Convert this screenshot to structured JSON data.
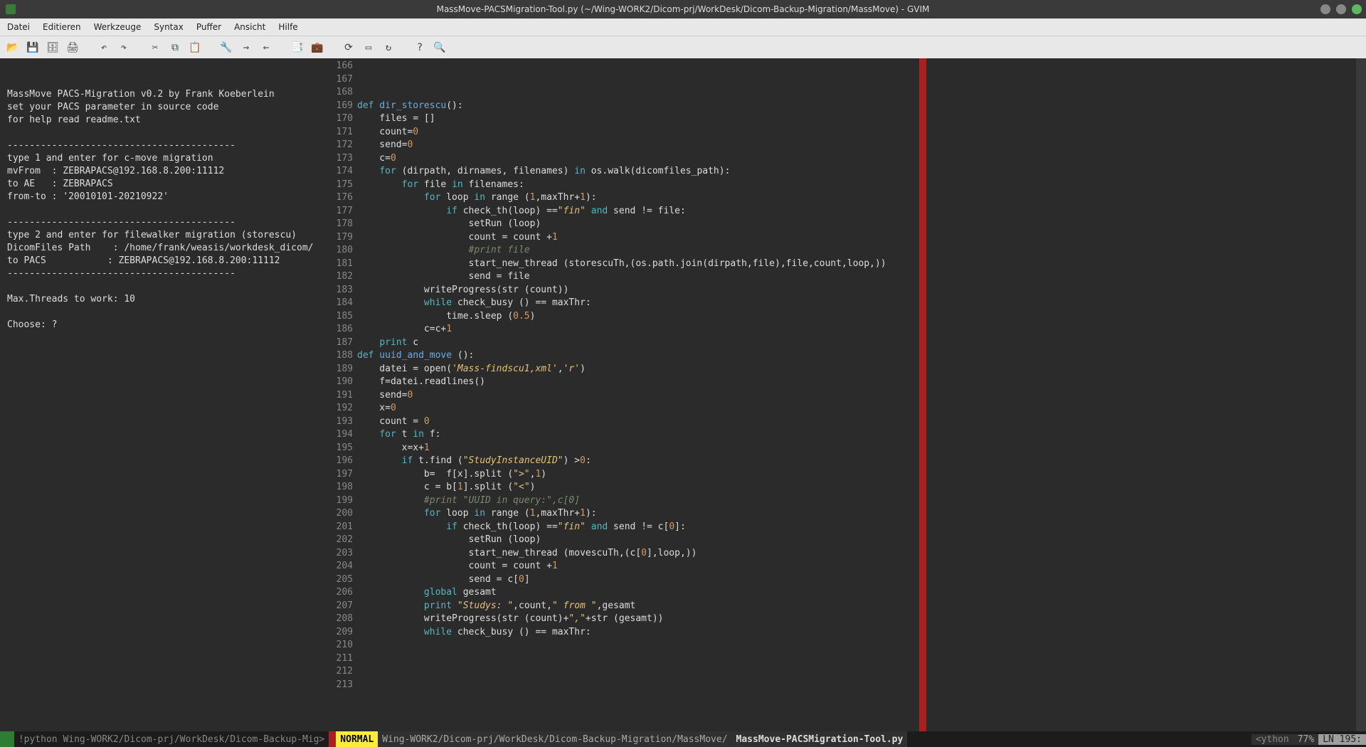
{
  "window": {
    "title": "MassMove-PACSMigration-Tool.py (~/Wing-WORK2/Dicom-prj/WorkDesk/Dicom-Backup-Migration/MassMove) - GVIM"
  },
  "menu": {
    "datei": "Datei",
    "editieren": "Editieren",
    "werkzeuge": "Werkzeuge",
    "syntax": "Syntax",
    "puffer": "Puffer",
    "ansicht": "Ansicht",
    "hilfe": "Hilfe"
  },
  "left_pane": {
    "lines": [
      "",
      "",
      "MassMove PACS-Migration v0.2 by Frank Koeberlein",
      "set your PACS parameter in source code",
      "for help read readme.txt",
      "",
      "-----------------------------------------",
      "type 1 and enter for c-move migration",
      "mvFrom  : ZEBRAPACS@192.168.8.200:11112",
      "to AE   : ZEBRAPACS",
      "from-to : '20010101-20210922'",
      "",
      "-----------------------------------------",
      "type 2 and enter for filewalker migration (storescu)",
      "DicomFiles Path    : /home/frank/weasis/workdesk_dicom/",
      "to PACS           : ZEBRAPACS@192.168.8.200:11112",
      "-----------------------------------------",
      "",
      "Max.Threads to work: 10",
      "",
      "Choose: ?"
    ]
  },
  "gutter": {
    "start": 166,
    "end": 213
  },
  "code": {
    "lines": [
      {
        "n": 166,
        "t": "def dir_storescu():",
        "h": [
          [
            "kw",
            "def"
          ],
          [
            "fn",
            " dir_storescu"
          ],
          [
            "",
            "():"
          ]
        ]
      },
      {
        "n": 167,
        "t": "    files = []",
        "h": [
          [
            "",
            "    files = []"
          ]
        ]
      },
      {
        "n": 168,
        "t": "    count=0",
        "h": [
          [
            "",
            "    count="
          ],
          [
            "num",
            "0"
          ]
        ]
      },
      {
        "n": 169,
        "t": "    send=0",
        "h": [
          [
            "",
            "    send="
          ],
          [
            "num",
            "0"
          ]
        ]
      },
      {
        "n": 170,
        "t": "    c=0",
        "h": [
          [
            "",
            "    c="
          ],
          [
            "num",
            "0"
          ]
        ]
      },
      {
        "n": 171,
        "t": "    for (dirpath, dirnames, filenames) in os.walk(dicomfiles_path):",
        "h": [
          [
            "",
            "    "
          ],
          [
            "kw",
            "for"
          ],
          [
            "",
            " (dirpath, dirnames, filenames) "
          ],
          [
            "kw",
            "in"
          ],
          [
            "",
            " os.walk(dicomfiles_path):"
          ]
        ]
      },
      {
        "n": 172,
        "t": "        for file in filenames:",
        "h": [
          [
            "",
            "        "
          ],
          [
            "kw",
            "for"
          ],
          [
            "",
            " file "
          ],
          [
            "kw",
            "in"
          ],
          [
            "",
            " filenames:"
          ]
        ]
      },
      {
        "n": 173,
        "t": "",
        "h": [
          [
            "",
            ""
          ]
        ]
      },
      {
        "n": 174,
        "t": "            for loop in range (1,maxThr+1):",
        "h": [
          [
            "",
            "            "
          ],
          [
            "kw",
            "for"
          ],
          [
            "",
            " loop "
          ],
          [
            "kw",
            "in"
          ],
          [
            "",
            " range ("
          ],
          [
            "num",
            "1"
          ],
          [
            "",
            ",maxThr+"
          ],
          [
            "num",
            "1"
          ],
          [
            "",
            "):"
          ]
        ]
      },
      {
        "n": 175,
        "t": "                if check_th(loop) ==\"fin\" and send != file:",
        "h": [
          [
            "",
            "                "
          ],
          [
            "kw",
            "if"
          ],
          [
            "",
            " check_th(loop) =="
          ],
          [
            "str",
            "\"fin\""
          ],
          [
            "",
            " "
          ],
          [
            "kw",
            "and"
          ],
          [
            "",
            " send != file:"
          ]
        ]
      },
      {
        "n": 176,
        "t": "                    setRun (loop)",
        "h": [
          [
            "",
            "                    setRun (loop)"
          ]
        ]
      },
      {
        "n": 177,
        "t": "                    count = count +1",
        "h": [
          [
            "",
            "                    count = count +"
          ],
          [
            "num",
            "1"
          ]
        ]
      },
      {
        "n": 178,
        "t": "                    #print file",
        "h": [
          [
            "",
            "                    "
          ],
          [
            "com",
            "#print file"
          ]
        ]
      },
      {
        "n": 179,
        "t": "                    start_new_thread (storescuTh,(os.path.join(dirpath,file),file,count,loop,))",
        "h": [
          [
            "",
            "                    start_new_thread (storescuTh,(os.path.join(dirpath,file),file,count,loop,))"
          ]
        ]
      },
      {
        "n": 180,
        "t": "                    send = file",
        "h": [
          [
            "",
            "                    send = file"
          ]
        ]
      },
      {
        "n": 181,
        "t": "",
        "h": [
          [
            "",
            ""
          ]
        ]
      },
      {
        "n": 182,
        "t": "            writeProgress(str (count))",
        "h": [
          [
            "",
            "            writeProgress(str (count))"
          ]
        ]
      },
      {
        "n": 183,
        "t": "            while check_busy () == maxThr:",
        "h": [
          [
            "",
            "            "
          ],
          [
            "kw",
            "while"
          ],
          [
            "",
            " check_busy () == maxThr:"
          ]
        ]
      },
      {
        "n": 184,
        "t": "                time.sleep (0.5)",
        "h": [
          [
            "",
            "                time.sleep ("
          ],
          [
            "num",
            "0.5"
          ],
          [
            "",
            ")"
          ]
        ]
      },
      {
        "n": 185,
        "t": "",
        "h": [
          [
            "",
            ""
          ]
        ]
      },
      {
        "n": 186,
        "t": "            c=c+1",
        "h": [
          [
            "",
            "            c=c+"
          ],
          [
            "num",
            "1"
          ]
        ]
      },
      {
        "n": 187,
        "t": "    print c",
        "h": [
          [
            "",
            "    "
          ],
          [
            "kw",
            "print"
          ],
          [
            "",
            " c"
          ]
        ]
      },
      {
        "n": 188,
        "t": "",
        "h": [
          [
            "",
            ""
          ]
        ]
      },
      {
        "n": 189,
        "t": "def uuid_and_move ():",
        "h": [
          [
            "kw",
            "def"
          ],
          [
            "fn",
            " uuid_and_move"
          ],
          [
            "",
            " ():"
          ]
        ]
      },
      {
        "n": 190,
        "t": "    datei = open('Mass-findscu1,xml','r')",
        "h": [
          [
            "",
            "    datei = open("
          ],
          [
            "str",
            "'Mass-findscu1,xml'"
          ],
          [
            "",
            ","
          ],
          [
            "str",
            "'r'"
          ],
          [
            "",
            ")"
          ]
        ]
      },
      {
        "n": 191,
        "t": "    f=datei.readlines()",
        "h": [
          [
            "",
            "    f=datei.readlines()"
          ]
        ]
      },
      {
        "n": 192,
        "t": "    send=0",
        "h": [
          [
            "",
            "    send="
          ],
          [
            "num",
            "0"
          ]
        ]
      },
      {
        "n": 193,
        "t": "    x=0",
        "h": [
          [
            "",
            "    x="
          ],
          [
            "num",
            "0"
          ]
        ]
      },
      {
        "n": 194,
        "t": "    count = 0",
        "h": [
          [
            "",
            "    count = "
          ],
          [
            "num",
            "0"
          ]
        ]
      },
      {
        "n": 195,
        "t": "    for t in f:",
        "h": [
          [
            "",
            "    "
          ],
          [
            "kw",
            "for"
          ],
          [
            "",
            " t "
          ],
          [
            "kw",
            "in"
          ],
          [
            "",
            " f:"
          ]
        ]
      },
      {
        "n": 196,
        "t": "        x=x+1",
        "h": [
          [
            "",
            "        x=x+"
          ],
          [
            "num",
            "1"
          ]
        ]
      },
      {
        "n": 197,
        "t": "        if t.find (\"StudyInstanceUID\") >0:",
        "h": [
          [
            "",
            "        "
          ],
          [
            "kw",
            "if"
          ],
          [
            "",
            " t.find ("
          ],
          [
            "str",
            "\"StudyInstanceUID\""
          ],
          [
            "",
            ") >"
          ],
          [
            "num",
            "0"
          ],
          [
            "",
            ":"
          ]
        ]
      },
      {
        "n": 198,
        "t": "            b=  f[x].split (\">\",1)",
        "h": [
          [
            "",
            "            b=  f[x].split ("
          ],
          [
            "str",
            "\">\""
          ],
          [
            "",
            ","
          ],
          [
            "num",
            "1"
          ],
          [
            "",
            ")"
          ]
        ]
      },
      {
        "n": 199,
        "t": "            c = b[1].split (\"<\")",
        "h": [
          [
            "",
            "            c = b["
          ],
          [
            "num",
            "1"
          ],
          [
            "",
            "].split ("
          ],
          [
            "str",
            "\"<\""
          ],
          [
            "",
            ")"
          ]
        ]
      },
      {
        "n": 200,
        "t": "            #print \"UUID in query:\",c[0]",
        "h": [
          [
            "",
            "            "
          ],
          [
            "com",
            "#print \"UUID in query:\",c[0]"
          ]
        ]
      },
      {
        "n": 201,
        "t": "",
        "h": [
          [
            "",
            ""
          ]
        ]
      },
      {
        "n": 202,
        "t": "            for loop in range (1,maxThr+1):",
        "h": [
          [
            "",
            "            "
          ],
          [
            "kw",
            "for"
          ],
          [
            "",
            " loop "
          ],
          [
            "kw",
            "in"
          ],
          [
            "",
            " range ("
          ],
          [
            "num",
            "1"
          ],
          [
            "",
            ",maxThr+"
          ],
          [
            "num",
            "1"
          ],
          [
            "",
            "):"
          ]
        ]
      },
      {
        "n": 203,
        "t": "                if check_th(loop) ==\"fin\" and send != c[0]:",
        "h": [
          [
            "",
            "                "
          ],
          [
            "kw",
            "if"
          ],
          [
            "",
            " check_th(loop) =="
          ],
          [
            "str",
            "\"fin\""
          ],
          [
            "",
            " "
          ],
          [
            "kw",
            "and"
          ],
          [
            "",
            " send != c["
          ],
          [
            "num",
            "0"
          ],
          [
            "",
            "]:"
          ]
        ]
      },
      {
        "n": 204,
        "t": "                    setRun (loop)",
        "h": [
          [
            "",
            "                    setRun (loop)"
          ]
        ]
      },
      {
        "n": 205,
        "t": "                    start_new_thread (movescuTh,(c[0],loop,))",
        "h": [
          [
            "",
            "                    start_new_thread (movescuTh,(c["
          ],
          [
            "num",
            "0"
          ],
          [
            "",
            "],loop,))"
          ]
        ]
      },
      {
        "n": 206,
        "t": "                    count = count +1",
        "h": [
          [
            "",
            "                    count = count +"
          ],
          [
            "num",
            "1"
          ]
        ]
      },
      {
        "n": 207,
        "t": "                    send = c[0]",
        "h": [
          [
            "",
            "                    send = c["
          ],
          [
            "num",
            "0"
          ],
          [
            "",
            "]"
          ]
        ]
      },
      {
        "n": 208,
        "t": "",
        "h": [
          [
            "",
            ""
          ]
        ]
      },
      {
        "n": 209,
        "t": "            global gesamt",
        "h": [
          [
            "",
            "            "
          ],
          [
            "kw",
            "global"
          ],
          [
            "",
            " gesamt"
          ]
        ]
      },
      {
        "n": 210,
        "t": "            print \"Studys: \",count,\" from \",gesamt",
        "h": [
          [
            "",
            "            "
          ],
          [
            "kw",
            "print"
          ],
          [
            "",
            " "
          ],
          [
            "str",
            "\"Studys: \""
          ],
          [
            "",
            ",count,"
          ],
          [
            "str",
            "\" from \""
          ],
          [
            "",
            ",gesamt"
          ]
        ]
      },
      {
        "n": 211,
        "t": "            writeProgress(str (count)+\",\"+str (gesamt))",
        "h": [
          [
            "",
            "            writeProgress(str (count)+"
          ],
          [
            "str",
            "\",\""
          ],
          [
            "",
            "+str (gesamt))"
          ]
        ]
      },
      {
        "n": 212,
        "t": "",
        "h": [
          [
            "",
            ""
          ]
        ]
      },
      {
        "n": 213,
        "t": "            while check_busy () == maxThr:",
        "h": [
          [
            "",
            "            "
          ],
          [
            "kw",
            "while"
          ],
          [
            "",
            " check_busy () == maxThr:"
          ]
        ]
      }
    ]
  },
  "status": {
    "left_cmd": "!python Wing-WORK2/Dicom-prj/WorkDesk/Dicom-Backup-Mig>",
    "mode": " NORMAL ",
    "path": " Wing-WORK2/Dicom-prj/WorkDesk/Dicom-Backup-Migration/MassMove/",
    "file": "MassMove-PACSMigration-Tool.py ",
    "filetype": " <ython ",
    "percent": " 77% ",
    "lineno": " LN  195:"
  }
}
